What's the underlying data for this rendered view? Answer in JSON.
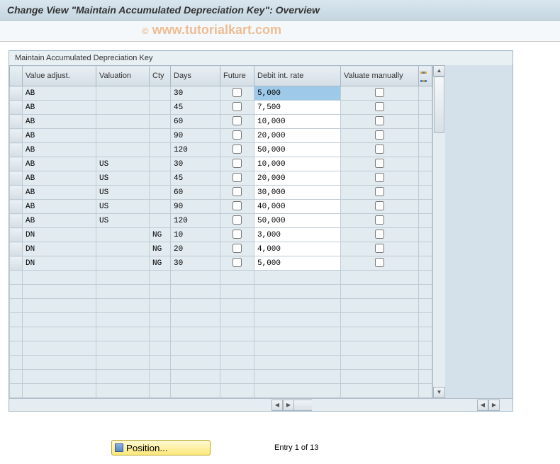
{
  "title": "Change View \"Maintain Accumulated Depreciation Key\": Overview",
  "watermark": "www.tutorialkart.com",
  "panel": {
    "title": "Maintain Accumulated Depreciation Key"
  },
  "columns": {
    "value_adjust": "Value adjust.",
    "valuation": "Valuation",
    "cty": "Cty",
    "days": "Days",
    "future": "Future",
    "debit": "Debit int. rate",
    "manual": "Valuate manually"
  },
  "rows": [
    {
      "va": "AB",
      "val": "",
      "cty": "",
      "days": "30",
      "future": false,
      "debit": "5,000",
      "manual": false,
      "debit_selected": true
    },
    {
      "va": "AB",
      "val": "",
      "cty": "",
      "days": "45",
      "future": false,
      "debit": "7,500",
      "manual": false
    },
    {
      "va": "AB",
      "val": "",
      "cty": "",
      "days": "60",
      "future": false,
      "debit": "10,000",
      "manual": false
    },
    {
      "va": "AB",
      "val": "",
      "cty": "",
      "days": "90",
      "future": false,
      "debit": "20,000",
      "manual": false
    },
    {
      "va": "AB",
      "val": "",
      "cty": "",
      "days": "120",
      "future": false,
      "debit": "50,000",
      "manual": false
    },
    {
      "va": "AB",
      "val": "US",
      "cty": "",
      "days": "30",
      "future": false,
      "debit": "10,000",
      "manual": false
    },
    {
      "va": "AB",
      "val": "US",
      "cty": "",
      "days": "45",
      "future": false,
      "debit": "20,000",
      "manual": false
    },
    {
      "va": "AB",
      "val": "US",
      "cty": "",
      "days": "60",
      "future": false,
      "debit": "30,000",
      "manual": false
    },
    {
      "va": "AB",
      "val": "US",
      "cty": "",
      "days": "90",
      "future": false,
      "debit": "40,000",
      "manual": false
    },
    {
      "va": "AB",
      "val": "US",
      "cty": "",
      "days": "120",
      "future": false,
      "debit": "50,000",
      "manual": false
    },
    {
      "va": "DN",
      "val": "",
      "cty": "NG",
      "days": "10",
      "future": false,
      "debit": "3,000",
      "manual": false
    },
    {
      "va": "DN",
      "val": "",
      "cty": "NG",
      "days": "20",
      "future": false,
      "debit": "4,000",
      "manual": false
    },
    {
      "va": "DN",
      "val": "",
      "cty": "NG",
      "days": "30",
      "future": false,
      "debit": "5,000",
      "manual": false
    }
  ],
  "empty_rows": 9,
  "footer": {
    "position_button": "Position...",
    "entry_text": "Entry 1 of 13"
  }
}
